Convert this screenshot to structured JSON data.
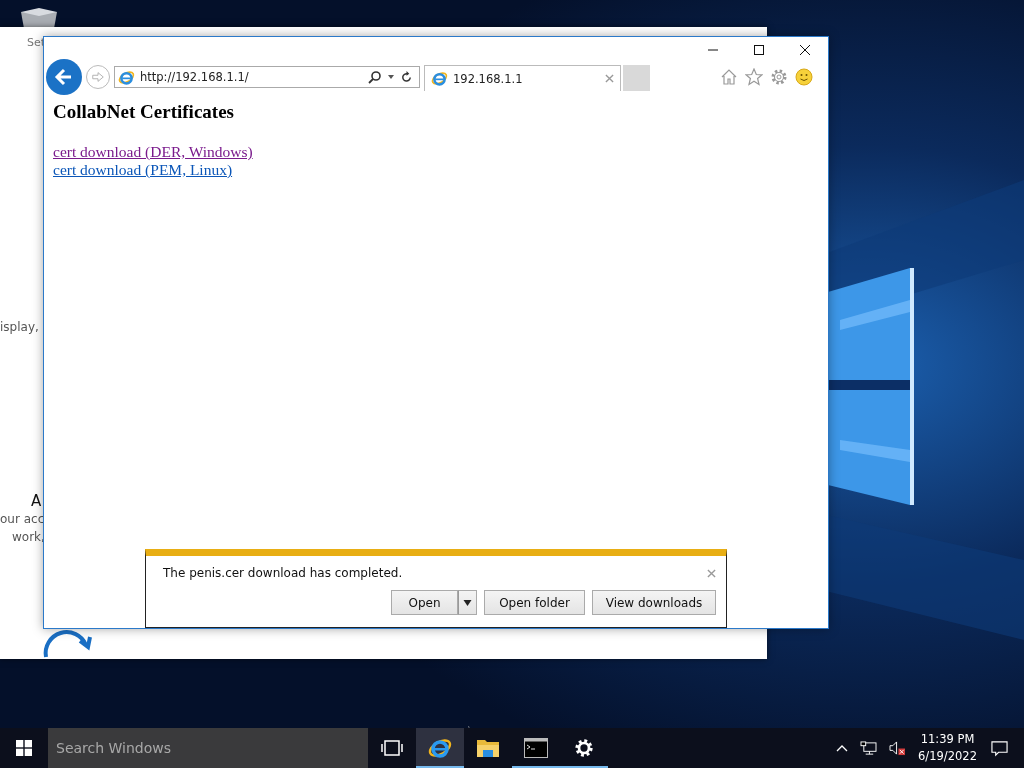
{
  "settings_window": {
    "title_fragment": "Set",
    "text_fragments": [
      "isplay,",
      "A",
      "our acc",
      "work,"
    ]
  },
  "browser": {
    "address": "http://192.168.1.1/",
    "tabs": [
      {
        "title": "192.168.1.1",
        "selected": true
      }
    ],
    "page": {
      "heading": "CollabNet Certificates",
      "links": [
        {
          "text": "cert download (DER, Windows)",
          "visited": true
        },
        {
          "text": "cert download (PEM, Linux)",
          "visited": false
        }
      ]
    },
    "download_bar": {
      "message": "The penis.cer download has completed.",
      "buttons": [
        "Open",
        "Open folder",
        "View downloads"
      ]
    }
  },
  "taskbar": {
    "search": {
      "placeholder": "Search Windows"
    },
    "apps": [
      {
        "kind": "browser",
        "active": true,
        "running": true
      },
      {
        "kind": "folder",
        "active": false,
        "running": false
      },
      {
        "kind": "terminal",
        "active": false,
        "running": true
      },
      {
        "kind": "settings",
        "active": false,
        "running": true
      }
    ],
    "clock": {
      "time": "11:39 PM",
      "date": "6/19/2022"
    }
  }
}
